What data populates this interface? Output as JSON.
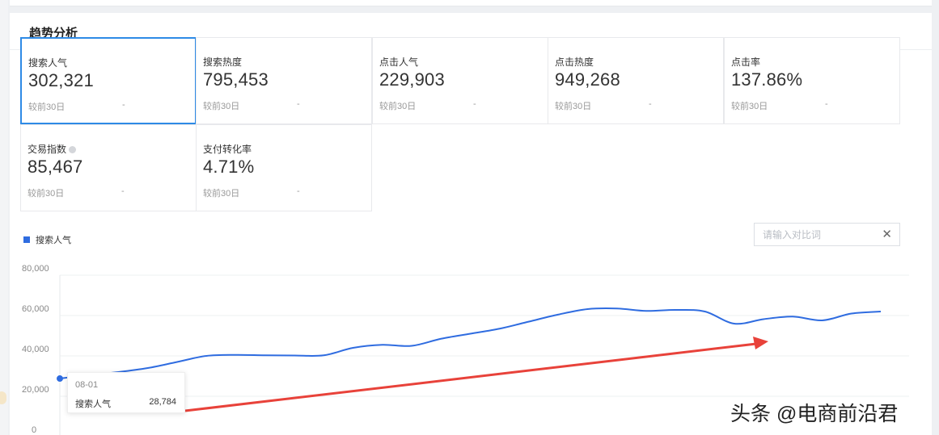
{
  "panel": {
    "title": "趋势分析"
  },
  "metrics": [
    {
      "label": "搜索人气",
      "value": "302,321",
      "compare": "较前30日",
      "delta": "-"
    },
    {
      "label": "搜索热度",
      "value": "795,453",
      "compare": "较前30日",
      "delta": "-"
    },
    {
      "label": "点击人气",
      "value": "229,903",
      "compare": "较前30日",
      "delta": "-"
    },
    {
      "label": "点击热度",
      "value": "949,268",
      "compare": "较前30日",
      "delta": "-"
    },
    {
      "label": "点击率",
      "value": "137.86%",
      "compare": "较前30日",
      "delta": "-"
    },
    {
      "label": "交易指数",
      "value": "85,467",
      "compare": "较前30日",
      "delta": "-"
    },
    {
      "label": "支付转化率",
      "value": "4.71%",
      "compare": "较前30日",
      "delta": "-"
    }
  ],
  "active_metric": "搜索人气",
  "compare_input": {
    "placeholder": "请输入对比词",
    "value": ""
  },
  "icons": {
    "close": "close-icon",
    "info": "info-icon"
  },
  "colors": {
    "line": "#2f6ce0",
    "active_border": "#2e8ae6",
    "arrow": "#e8423a"
  },
  "tooltip": {
    "date": "08-01",
    "series": "搜索人气",
    "value": "28,784"
  },
  "watermark": "头条 @电商前沿君",
  "chart_data": {
    "type": "line",
    "legend": "搜索人气",
    "y_ticks": [
      "80,000",
      "60,000",
      "40,000",
      "20,000",
      "0"
    ],
    "ylim": [
      0,
      80000
    ],
    "grid": true,
    "series": [
      {
        "name": "搜索人气",
        "values": [
          28784,
          30500,
          32000,
          34000,
          37000,
          40000,
          40500,
          40300,
          40200,
          40300,
          44000,
          45500,
          45000,
          48500,
          51000,
          53500,
          57000,
          60500,
          63200,
          63500,
          62300,
          62800,
          62000,
          56000,
          58200,
          59500,
          57600,
          61000,
          62000
        ]
      }
    ]
  }
}
